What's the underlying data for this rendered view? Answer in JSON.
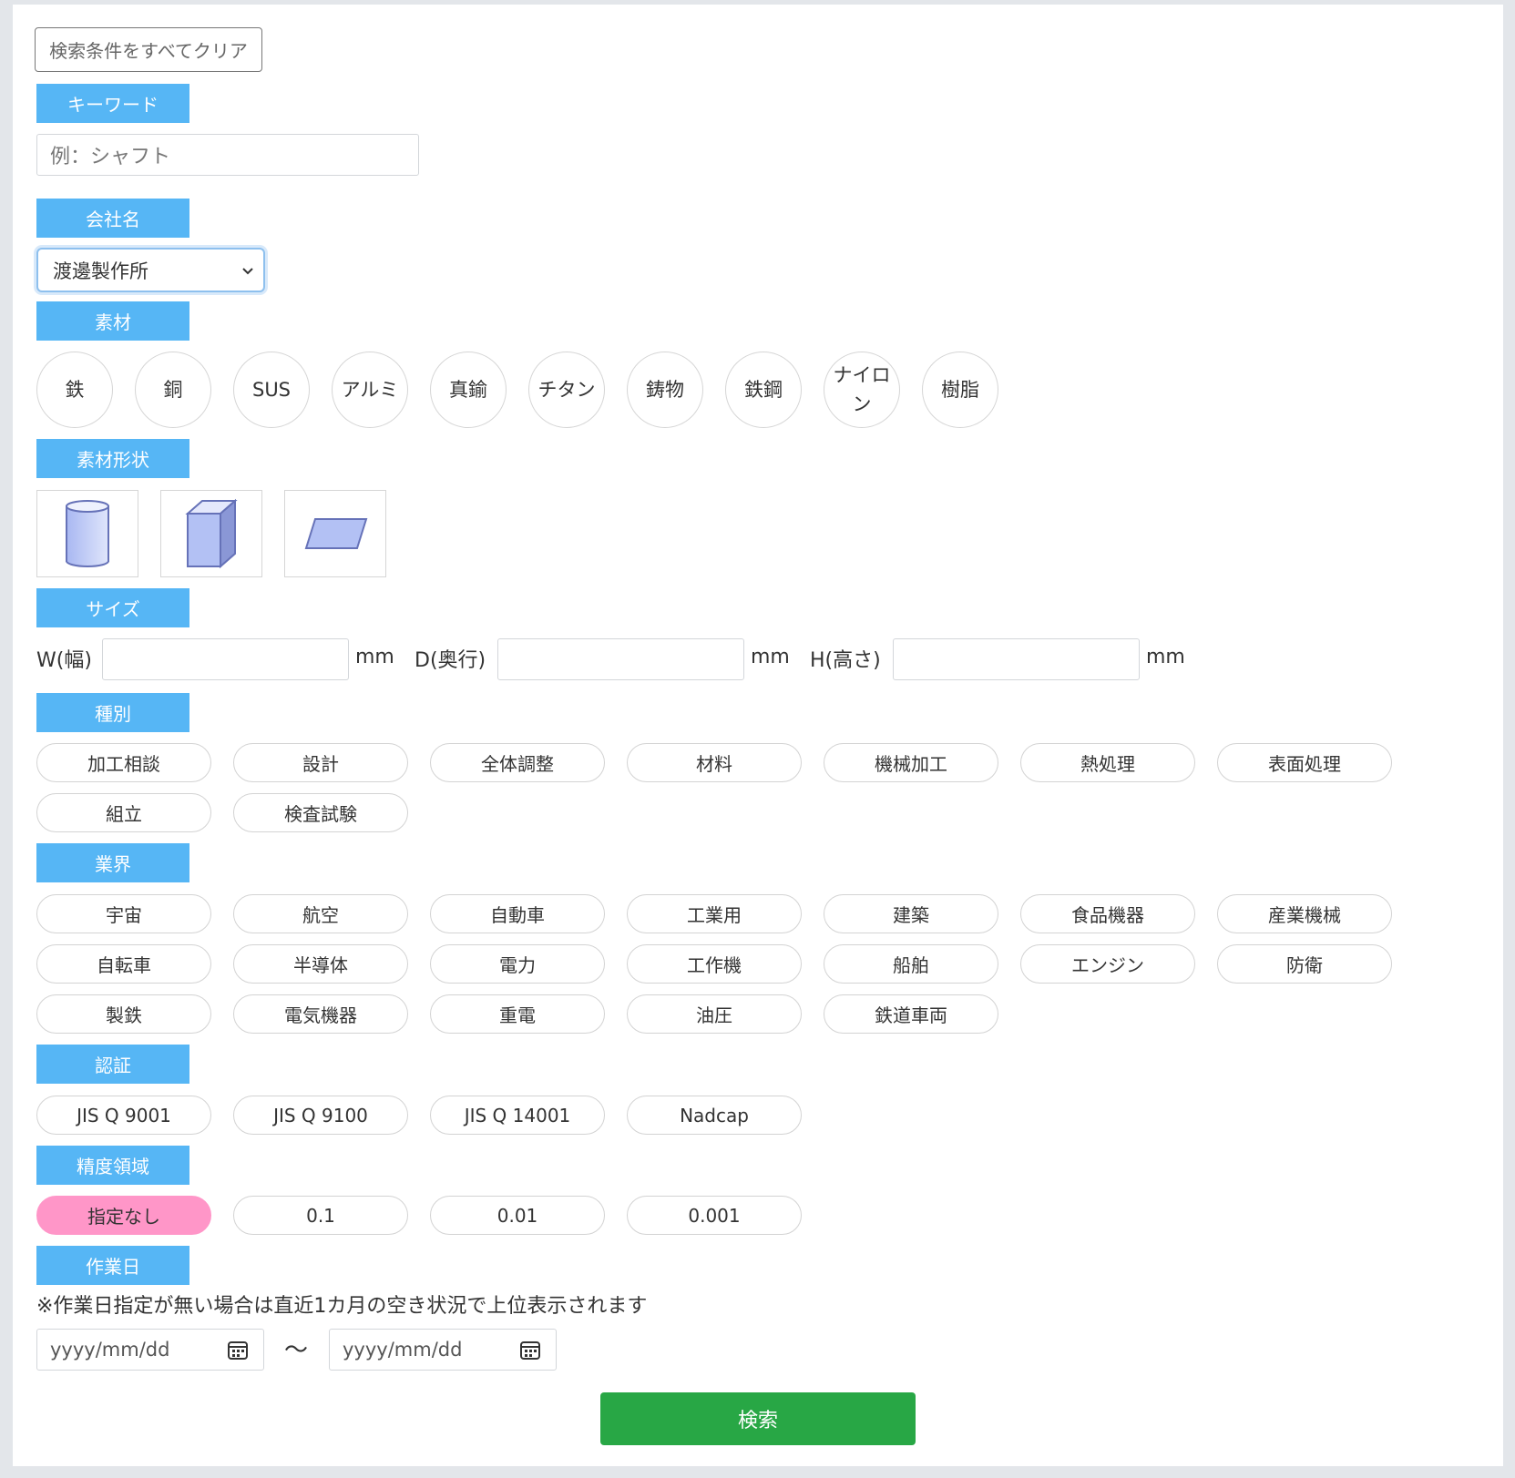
{
  "clear_button": "検索条件をすべてクリア",
  "keyword": {
    "label": "キーワード",
    "placeholder": "例：シャフト"
  },
  "company": {
    "label": "会社名",
    "selected": "渡邊製作所"
  },
  "material": {
    "label": "素材",
    "items": [
      "鉄",
      "銅",
      "SUS",
      "アルミ",
      "真鍮",
      "チタン",
      "鋳物",
      "鉄鋼",
      "ナイロン",
      "樹脂"
    ]
  },
  "shape": {
    "label": "素材形状",
    "items": [
      "cylinder-icon",
      "box-icon",
      "plate-icon"
    ]
  },
  "size": {
    "label": "サイズ",
    "fields": [
      {
        "label": "W(幅)",
        "unit": "mm"
      },
      {
        "label": "D(奥行)",
        "unit": "mm"
      },
      {
        "label": "H(高さ)",
        "unit": "mm"
      }
    ]
  },
  "category": {
    "label": "種別",
    "items": [
      "加工相談",
      "設計",
      "全体調整",
      "材料",
      "機械加工",
      "熱処理",
      "表面処理",
      "組立",
      "検査試験"
    ]
  },
  "industry": {
    "label": "業界",
    "items": [
      "宇宙",
      "航空",
      "自動車",
      "工業用",
      "建築",
      "食品機器",
      "産業機械",
      "自転車",
      "半導体",
      "電力",
      "工作機",
      "船舶",
      "エンジン",
      "防衛",
      "製鉄",
      "電気機器",
      "重電",
      "油圧",
      "鉄道車両"
    ]
  },
  "certification": {
    "label": "認証",
    "items": [
      "JIS Q 9001",
      "JIS Q 9100",
      "JIS Q 14001",
      "Nadcap"
    ]
  },
  "precision": {
    "label": "精度領域",
    "items": [
      "指定なし",
      "0.1",
      "0.01",
      "0.001"
    ],
    "selected_index": 0
  },
  "work_date": {
    "label": "作業日",
    "note": "※作業日指定が無い場合は直近1カ月の空き状況で上位表示されます",
    "from_placeholder": "yyyy/mm/dd",
    "separator": "～",
    "to_placeholder": "yyyy/mm/dd"
  },
  "search_button": "検索",
  "colors": {
    "label_bg": "#56b6f5",
    "active_pill": "#ff96c8",
    "search_button": "#28a745"
  }
}
